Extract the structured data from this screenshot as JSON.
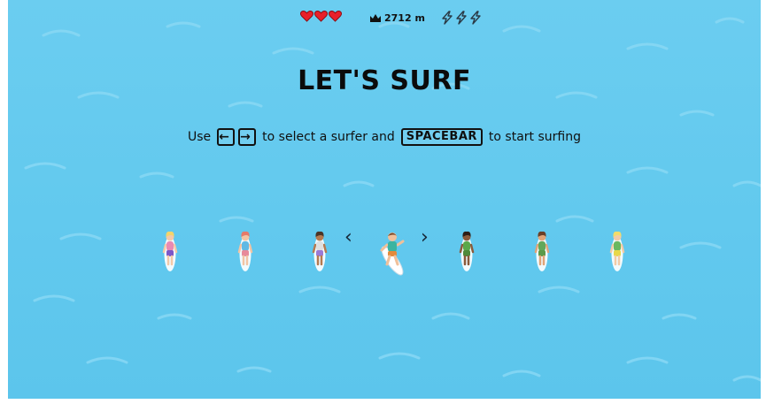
{
  "hud": {
    "lives": 3,
    "distance_text": "2712 m",
    "boosts": 3,
    "icons": {
      "lives": "heart-icon",
      "distance": "crown-icon",
      "boosts": "lightning-bolt-icon"
    },
    "colors": {
      "heart": "#e8202a",
      "bolt": "#7a8a96"
    }
  },
  "title": "LET'S SURF",
  "instructions": {
    "use": "Use",
    "left_key": "←",
    "right_key": "→",
    "middle": "to select a surfer and",
    "space_key": "SPACEBAR",
    "end": "to start surfing"
  },
  "selector": {
    "prev": "‹",
    "next": "›",
    "selected_index": 3,
    "surfers": [
      {
        "hair": "#f3d46a",
        "skin": "#f4c9a8",
        "top": "#e98ab3",
        "shorts": "#7c57c7"
      },
      {
        "hair": "#e47a6a",
        "skin": "#f2c4a4",
        "top": "#5fb9e4",
        "shorts": "#e78a9a"
      },
      {
        "hair": "#4a3426",
        "skin": "#b57a50",
        "top": "#e0e0e0",
        "shorts": "#9a7ad6"
      },
      {
        "hair": "#7a4a2a",
        "skin": "#f0c09a",
        "top": "#3bb4a0",
        "shorts": "#e48a3a"
      },
      {
        "hair": "#2d1e16",
        "skin": "#8a5a3a",
        "top": "#5aa84a",
        "shorts": "#4f8a3a"
      },
      {
        "hair": "#6a4028",
        "skin": "#e0a478",
        "top": "#62a85a",
        "shorts": "#5a9a4a"
      },
      {
        "hair": "#f4dc6a",
        "skin": "#f4cba6",
        "top": "#6ab860",
        "shorts": "#e8d84a"
      }
    ]
  },
  "colors": {
    "water": "#62c9ee",
    "text": "#0b0b0b"
  }
}
